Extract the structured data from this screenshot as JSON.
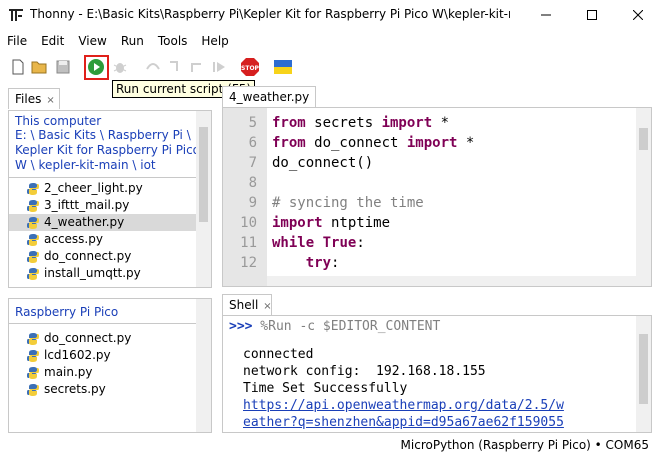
{
  "window": {
    "title": "Thonny  -  E:\\Basic Kits\\Raspberry Pi\\Kepler Kit for Raspberry Pi Pico W\\kepler-kit-main\\iot..."
  },
  "menu": [
    "File",
    "Edit",
    "View",
    "Run",
    "Tools",
    "Help"
  ],
  "toolbar": {
    "tooltip": "Run current script (F5)",
    "icons": [
      "new-file",
      "open-folder",
      "save",
      "run",
      "debug",
      "step-over",
      "step-into",
      "step-out",
      "resume",
      "stop",
      "ukraine-flag"
    ],
    "stop_label": "STOP"
  },
  "files_panel": {
    "tab_label": "Files",
    "tab_close": "×",
    "computer": {
      "title": "This computer",
      "path_lines": [
        "E: \\ Basic Kits \\ Raspberry Pi \\",
        "Kepler Kit for Raspberry Pi Pico",
        "W \\ kepler-kit-main \\ iot"
      ],
      "files": [
        "2_cheer_light.py",
        "3_ifttt_mail.py",
        "4_weather.py",
        "access.py",
        "do_connect.py",
        "install_umqtt.py"
      ],
      "selected": "4_weather.py"
    },
    "device": {
      "title": "Raspberry Pi Pico",
      "files": [
        "do_connect.py",
        "lcd1602.py",
        "main.py",
        "secrets.py"
      ]
    }
  },
  "editor": {
    "tab_label": "4_weather.py",
    "line_numbers": [
      "5",
      "6",
      "7",
      "8",
      "9",
      "10",
      "11",
      "12"
    ],
    "lines": [
      [
        {
          "t": "from",
          "k": "kw"
        },
        {
          "t": " secrets "
        },
        {
          "t": "import",
          "k": "kw"
        },
        {
          "t": " *"
        }
      ],
      [
        {
          "t": "from",
          "k": "kw"
        },
        {
          "t": " do_connect "
        },
        {
          "t": "import",
          "k": "kw"
        },
        {
          "t": " *"
        }
      ],
      [
        {
          "t": "do_connect()"
        }
      ],
      [
        {
          "t": ""
        }
      ],
      [
        {
          "t": "# syncing the time",
          "k": "cm"
        }
      ],
      [
        {
          "t": "import",
          "k": "kw"
        },
        {
          "t": " ntptime"
        }
      ],
      [
        {
          "t": "while",
          "k": "kw"
        },
        {
          "t": " "
        },
        {
          "t": "True",
          "k": "kw"
        },
        {
          "t": ":"
        }
      ],
      [
        {
          "t": "    "
        },
        {
          "t": "try",
          "k": "kw"
        },
        {
          "t": ":"
        }
      ]
    ]
  },
  "shell": {
    "tab_label": "Shell",
    "tab_close": "×",
    "prompt": ">>>",
    "command": " %Run -c $EDITOR_CONTENT",
    "output": [
      "connected",
      "network config:  192.168.18.155",
      "Time Set Successfully"
    ],
    "link_lines": [
      "https://api.openweathermap.org/data/2.5/w",
      "eather?q=shenzhen&appid=d95a67ae62f159055"
    ]
  },
  "status": {
    "text": "MicroPython (Raspberry Pi Pico)  •  COM65"
  },
  "colors": {
    "keyword": "#7f0055",
    "link": "#1a3fb8",
    "highlight_box": "#e0201a"
  }
}
